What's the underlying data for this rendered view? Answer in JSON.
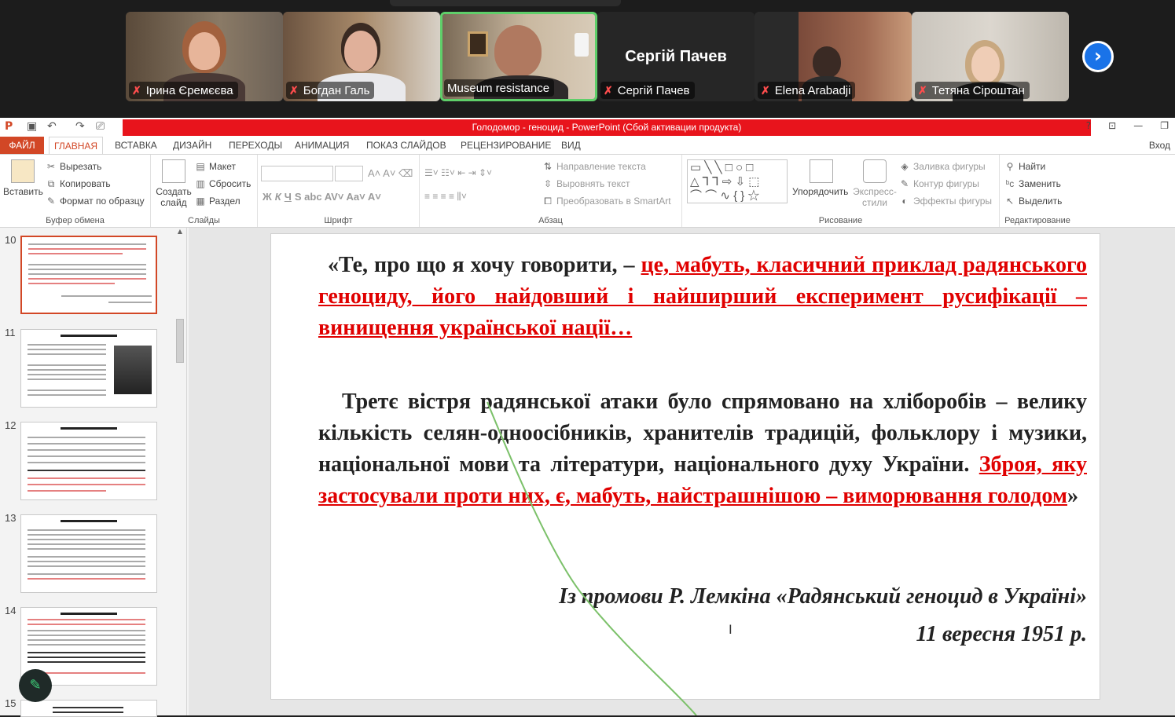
{
  "participants": [
    {
      "name": "Ірина Єремєєва",
      "muted": true
    },
    {
      "name": "Богдан Галь",
      "muted": true
    },
    {
      "name": "Museum resistance",
      "muted": false,
      "active": true
    },
    {
      "name": "Сергій Пачев",
      "muted": true,
      "big_name": "Сергій Пачев"
    },
    {
      "name": "Elena Arabadji",
      "muted": true
    },
    {
      "name": "Тетяна Сіроштан",
      "muted": true
    }
  ],
  "icons": {
    "mic_muted": "muted-mic-icon",
    "next": "chevron-right-icon",
    "pen": "pen-icon"
  },
  "window": {
    "title": "Голодомор - геноцид - PowerPoint (Сбой активации продукта)",
    "help": "?",
    "login": "Вход"
  },
  "tabs": [
    "ФАЙЛ",
    "ГЛАВНАЯ",
    "ВСТАВКА",
    "ДИЗАЙН",
    "ПЕРЕХОДЫ",
    "АНИМАЦИЯ",
    "ПОКАЗ СЛАЙДОВ",
    "РЕЦЕНЗИРОВАНИЕ",
    "ВИД"
  ],
  "ribbon": {
    "clipboard": {
      "paste": "Вставить",
      "cut": "Вырезать",
      "copy": "Копировать",
      "format": "Формат по образцу",
      "label": "Буфер обмена"
    },
    "slides": {
      "new": "Создать слайд",
      "layout": "Макет",
      "reset": "Сбросить",
      "section": "Раздел",
      "label": "Слайды"
    },
    "font": {
      "label": "Шрифт"
    },
    "paragraph": {
      "direction": "Направление текста",
      "align": "Выровнять текст",
      "smartart": "Преобразовать в SmartArt",
      "label": "Абзац"
    },
    "drawing": {
      "arrange": "Упорядочить",
      "styles": "Экспресс-стили",
      "fill": "Заливка фигуры",
      "outline": "Контур фигуры",
      "effects": "Эффекты фигуры",
      "label": "Рисование"
    },
    "editing": {
      "find": "Найти",
      "replace": "Заменить",
      "select": "Выделить",
      "label": "Редактирование"
    }
  },
  "thumbnails": [
    10,
    11,
    12,
    13,
    14,
    15
  ],
  "selected_slide": 10,
  "slide": {
    "p1_black": "«Те, про що я хочу говорити, – ",
    "p1_red": "це, мабуть, класичний приклад радянського геноциду, його найдовший і найширший експеримент русифікації – винищення української нації…",
    "p2_black": "Третє вістря радянської атаки було спрямовано на хліборобів – велику кількість селян-одноосібників, хранителів традицій, фольклору і музики, національної мови та літератури, національного духу України. ",
    "p2_red": "Зброя, яку застосували проти них, є, мабуть, найстрашнішою – виморювання голодом",
    "p2_end": "»",
    "signature": "Із промови Р. Лемкіна «Радянський геноцид в Україні»",
    "date": "11 вересня 1951 р."
  }
}
